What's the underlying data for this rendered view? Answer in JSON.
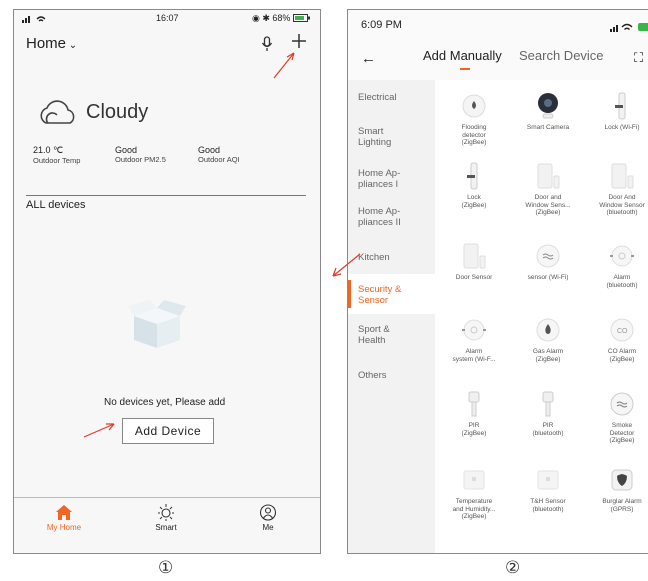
{
  "panel1": {
    "status": {
      "time": "16:07",
      "battery": "68%"
    },
    "home_title": "Home",
    "weather": {
      "condition": "Cloudy",
      "metrics": [
        {
          "value": "21.0 ℃",
          "label": "Outdoor Temp"
        },
        {
          "value": "Good",
          "label": "Outdoor PM2.5"
        },
        {
          "value": "Good",
          "label": "Outdoor AQI"
        }
      ]
    },
    "section_title": "ALL devices",
    "empty_text": "No devices yet, Please add",
    "add_button": "Add Device",
    "tabs": [
      {
        "label": "My Home",
        "icon": "home-icon",
        "active": true
      },
      {
        "label": "Smart",
        "icon": "sun-icon",
        "active": false
      },
      {
        "label": "Me",
        "icon": "user-icon",
        "active": false
      }
    ],
    "caption": "①"
  },
  "panel2": {
    "status": {
      "time": "6:09 PM"
    },
    "tabs": {
      "manual": "Add Manually",
      "search": "Search Device"
    },
    "categories": [
      {
        "label": "Electrical"
      },
      {
        "label": "Smart\nLighting"
      },
      {
        "label": "Home Ap-\npliances I"
      },
      {
        "label": "Home Ap-\npliances II"
      },
      {
        "label": "Kitchen"
      },
      {
        "label": "Security &\nSensor",
        "active": true
      },
      {
        "label": "Sport &\nHealth"
      },
      {
        "label": "Others"
      }
    ],
    "devices": [
      {
        "label": "Flooding\ndetector\n(ZigBee)",
        "icon": "water-drop-icon"
      },
      {
        "label": "Smart Camera",
        "icon": "camera-icon"
      },
      {
        "label": "Lock (Wi-Fi)",
        "icon": "lock-icon"
      },
      {
        "label": "Lock\n(ZigBee)",
        "icon": "lock-icon"
      },
      {
        "label": "Door and\nWindow Sens...\n(ZigBee)",
        "icon": "door-sensor-icon"
      },
      {
        "label": "Door And\nWindow Sensor\n(bluetooth)",
        "icon": "door-sensor-icon"
      },
      {
        "label": "Door Sensor",
        "icon": "door-sensor-icon"
      },
      {
        "label": "sensor (Wi-Fi)",
        "icon": "wave-sensor-icon"
      },
      {
        "label": "Alarm\n(bluetooth)",
        "icon": "alarm-icon"
      },
      {
        "label": "Alarm\nsystem (Wi-F...",
        "icon": "alarm-icon"
      },
      {
        "label": "Gas Alarm\n(ZigBee)",
        "icon": "flame-icon"
      },
      {
        "label": "CO Alarm\n(ZigBee)",
        "icon": "co-icon"
      },
      {
        "label": "PIR\n(ZigBee)",
        "icon": "pir-icon"
      },
      {
        "label": "PIR\n(bluetooth)",
        "icon": "pir-icon"
      },
      {
        "label": "Smoke\nDetector\n(ZigBee)",
        "icon": "smoke-icon"
      },
      {
        "label": "Temperature\nand Humidity...\n(ZigBee)",
        "icon": "thermo-icon"
      },
      {
        "label": "T&H Sensor\n(bluetooth)",
        "icon": "thermo-icon"
      },
      {
        "label": "Burglar Alarm\n(GPRS)",
        "icon": "shield-icon"
      }
    ],
    "caption": "②"
  },
  "colors": {
    "accent": "#f26522",
    "arrow": "#e03a2a"
  }
}
